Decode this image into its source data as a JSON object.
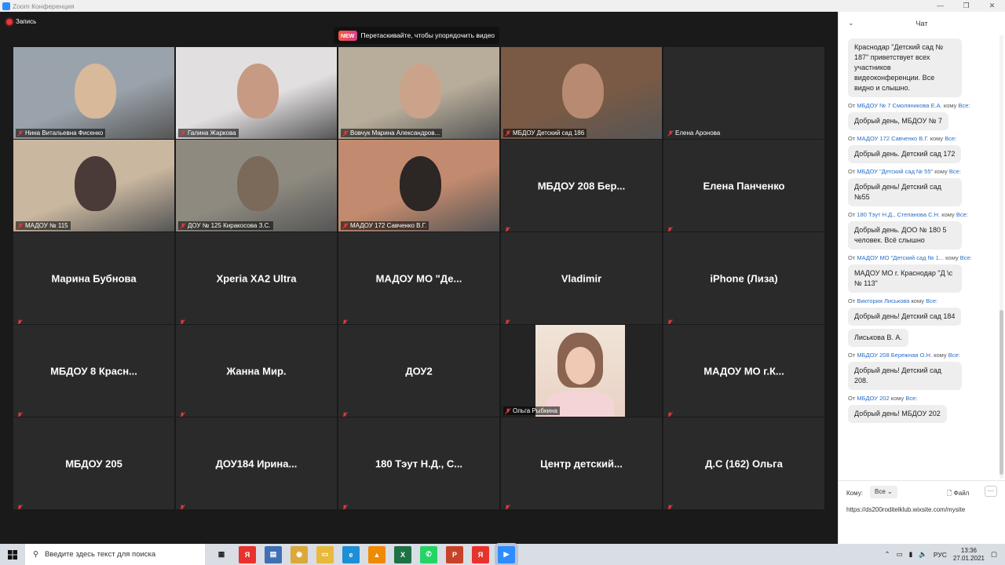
{
  "window": {
    "title": "Zoom Конференция"
  },
  "recording": {
    "label": "Запись"
  },
  "banner": {
    "badge": "NEW",
    "text": "Перетаскивайте, чтобы упорядочить видео"
  },
  "tiles": [
    {
      "label": "Нина Витальевна Фисенко",
      "video": true,
      "active": true
    },
    {
      "label": "Галина Жаркова",
      "video": true
    },
    {
      "label": "Вовчук Марина Александров...",
      "video": true
    },
    {
      "label": "МБДОУ Детский сад 186",
      "video": true
    },
    {
      "label": "Елена Аронова",
      "video": false,
      "small": true
    },
    {
      "label": "МАДОУ № 115",
      "video": true
    },
    {
      "label": "ДОУ № 125 Киракосова З.С.",
      "video": true
    },
    {
      "label": "МАДОУ 172 Савченко В.Г.",
      "video": true
    },
    {
      "name": "МБДОУ 208 Бер..."
    },
    {
      "name": "Елена Панченко"
    },
    {
      "name": "Марина Бубнова"
    },
    {
      "name": "Xperia XA2 Ultra"
    },
    {
      "name": "МАДОУ МО \"Де..."
    },
    {
      "name": "Vladimir"
    },
    {
      "name": "iPhone (Лиза)"
    },
    {
      "name": "МБДОУ 8 Красн..."
    },
    {
      "name": "Жанна Мир."
    },
    {
      "name": "ДОУ2"
    },
    {
      "label": "Ольга Рыбкина",
      "video": true,
      "portrait": true
    },
    {
      "name": "МАДОУ МО г.К..."
    },
    {
      "name": "МБДОУ 205"
    },
    {
      "name": "ДОУ184 Ирина..."
    },
    {
      "name": "180 Тэут Н.Д., С..."
    },
    {
      "name": "Центр детский..."
    },
    {
      "name": "Д.С (162) Ольга"
    }
  ],
  "chat": {
    "title": "Чат",
    "from_prefix": "От",
    "to_word": "кому",
    "messages": [
      {
        "from": "",
        "to": "",
        "text": "Краснодар \"Детский сад № 187\" приветствует всех участников видеоконференции. Все видно и слышно."
      },
      {
        "from": "МБДОУ № 7 Смоляникова Е.А.",
        "to": "Все:",
        "text": "Добрый день, МБДОУ № 7"
      },
      {
        "from": "МАДОУ 172 Савченко В.Г.",
        "to": "Все:",
        "text": "Добрый день. Детский сад 172"
      },
      {
        "from": "МБДОУ \"Детский сад № 55\"",
        "to": "Все:",
        "text": "Добрый день! Детский сад №55"
      },
      {
        "from": "180 Тэут Н.Д., Степанова С.Н.",
        "to": "Все:",
        "text": "Добрый день. ДОО № 180 5 человек. Всё слышно"
      },
      {
        "from": "МАДОУ МО \"Детский сад № 1...",
        "to": "Все:",
        "text": "МАДОУ МО г. Краснодар \"Д \\с № 113\""
      },
      {
        "from": "Виктория Лиськова",
        "to": "Все:",
        "text": "Добрый день! Детский сад 184"
      },
      {
        "from": "",
        "to": "",
        "text": "Лиськова В. А."
      },
      {
        "from": "МБДОУ 208 Бережная О.Н.",
        "to": "Все:",
        "text": "Добрый день! Детский сад 208."
      },
      {
        "from": "МБДОУ 202",
        "to": "Все:",
        "text": "Добрый день! МБДОУ 202"
      }
    ],
    "footer": {
      "to_label": "Кому:",
      "recipient": "Все",
      "file_label": "Файл",
      "more": "···",
      "draft": "https://ds200roditelklub.wixsite.com/mysite"
    }
  },
  "taskbar": {
    "search_placeholder": "Введите здесь текст для поиска",
    "apps": [
      {
        "name": "task-view",
        "color": "#d9dde4",
        "glyph": "▦"
      },
      {
        "name": "yandex-browser",
        "color": "#e8332d",
        "glyph": "Я"
      },
      {
        "name": "calculator",
        "color": "#3f6fb5",
        "glyph": "▤"
      },
      {
        "name": "chrome",
        "color": "#dba83a",
        "glyph": "◉"
      },
      {
        "name": "file-explorer",
        "color": "#e9b93d",
        "glyph": "▭"
      },
      {
        "name": "edge",
        "color": "#1e8ed6",
        "glyph": "e"
      },
      {
        "name": "vlc",
        "color": "#f08a00",
        "glyph": "▲"
      },
      {
        "name": "excel",
        "color": "#1d7145",
        "glyph": "X"
      },
      {
        "name": "whatsapp",
        "color": "#25d366",
        "glyph": "✆"
      },
      {
        "name": "powerpoint",
        "color": "#c6432a",
        "glyph": "P"
      },
      {
        "name": "yandex",
        "color": "#e8332d",
        "glyph": "Я"
      },
      {
        "name": "zoom",
        "color": "#2d8cff",
        "glyph": "▶"
      }
    ],
    "lang": "РУС",
    "time": "13:36",
    "date": "27.01.2021"
  }
}
